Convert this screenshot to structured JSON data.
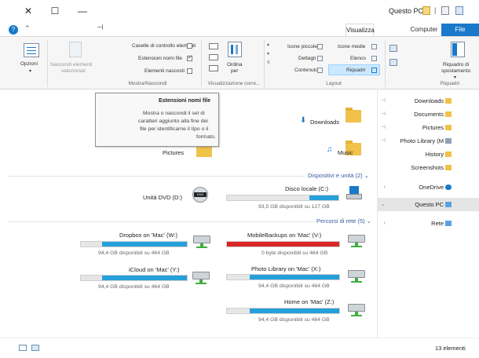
{
  "window": {
    "title": "Questo PC"
  },
  "tabs": {
    "file": "File",
    "computer": "Computer",
    "view": "Visualizza"
  },
  "ribbon": {
    "options": "Opzioni",
    "show_hide": {
      "group_label": "Mostra/Nascondi",
      "item_checkboxes": "Caselle di controllo elementi",
      "file_extensions": "Estensioni nomi file",
      "hidden_items": "Elementi nascosti",
      "hide_selected_line1": "Nascondi elementi",
      "hide_selected_line2": "selezionati"
    },
    "current_view": {
      "group_label": "Visualizzazione corre...",
      "sort_by_line1": "Ordina",
      "sort_by_line2": "per"
    },
    "layout": {
      "group_label": "Layout",
      "medium_icons": "Icone medie",
      "small_icons": "Icone piccole",
      "list": "Elenco",
      "details": "Dettagli",
      "tiles": "Riquadri",
      "content": "Contenuto"
    },
    "panes": {
      "group_label": "Riquadri",
      "nav_pane_line1": "Riquadro di",
      "nav_pane_line2": "spostamento"
    }
  },
  "tooltip": {
    "title": "Estensioni nomi file",
    "line1": "Mostra o nascondi il set di",
    "line2": "caratteri aggiunto alla fine dei",
    "line3": "file per identificarne il tipo o il",
    "line4": "formato."
  },
  "folders": {
    "downloads": "Downloads",
    "music": "Music",
    "pictures": "Pictures"
  },
  "sections": {
    "devices": "Dispositivi e unità (2)",
    "network": "Percorsi di rete (5)"
  },
  "devices": [
    {
      "name": "Disco locale (C:)",
      "free": "93,5 GB disponibili su 127 GB",
      "used_fraction": 0.26,
      "color": "#26a0da"
    },
    {
      "name": "Unità DVD (D:)"
    }
  ],
  "network": [
    {
      "name": "MobileBackups on 'Mac' (V:)",
      "free": "0 byte disponibili su 464 GB",
      "used_fraction": 1.0,
      "color": "#da2626"
    },
    {
      "name": "Dropbox on 'Mac' (W:)",
      "free": "94,4 GB disponibili su 464 GB",
      "used_fraction": 0.8,
      "color": "#26a0da"
    },
    {
      "name": "Photo Library on 'Mac' (X:)",
      "free": "94,4 GB disponibili su 464 GB",
      "used_fraction": 0.8,
      "color": "#26a0da"
    },
    {
      "name": "iCloud on 'Mac' (Y:)",
      "free": "94,4 GB disponibili su 464 GB",
      "used_fraction": 0.8,
      "color": "#26a0da"
    },
    {
      "name": "Home on 'Mac' (Z:)",
      "free": "94,4 GB disponibili su 464 GB",
      "used_fraction": 0.8,
      "color": "#26a0da"
    }
  ],
  "nav": {
    "downloads": "Downloads",
    "documents": "Documents",
    "pictures": "Pictures",
    "photo_library": "Photo Library (M",
    "history": "History",
    "screenshots": "Screenshots",
    "onedrive": "OneDrive",
    "this_pc": "Questo PC",
    "network": "Rete"
  },
  "status": {
    "count": "13 elementi"
  },
  "colors": {
    "accent": "#1979ca",
    "drive_bar": "#26a0da",
    "drive_full": "#da2626"
  }
}
